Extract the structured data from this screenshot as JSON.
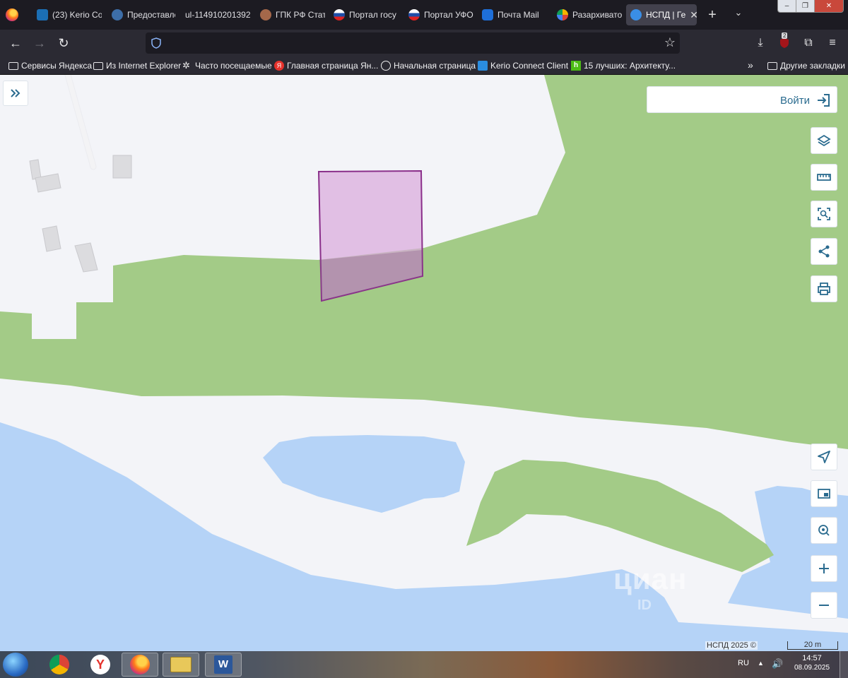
{
  "browser": {
    "tabs": [
      {
        "label": "(23) Kerio Co",
        "active": false
      },
      {
        "label": "Предоставле",
        "active": false
      },
      {
        "label": "ul-114910201392",
        "active": false
      },
      {
        "label": "ГПК РФ Стат",
        "active": false
      },
      {
        "label": "Портал госу",
        "active": false
      },
      {
        "label": "Портал УФО",
        "active": false
      },
      {
        "label": "Почта Mail",
        "active": false
      },
      {
        "label": "Разархивато",
        "active": false
      },
      {
        "label": "НСПД | Ге",
        "active": true
      }
    ],
    "url": "",
    "download_badge": "2"
  },
  "bookmarks": [
    {
      "label": "Сервисы Яндекса",
      "icon": "folder-icon"
    },
    {
      "label": "Из Internet Explorer",
      "icon": "folder-icon"
    },
    {
      "label": "Часто посещаемые",
      "icon": "gear-icon"
    },
    {
      "label": "Главная страница Ян...",
      "icon": "yandex-icon"
    },
    {
      "label": "Начальная страница",
      "icon": "globe-icon"
    },
    {
      "label": "Kerio Connect Client",
      "icon": "mail-icon"
    },
    {
      "label": "15 лучших: Архитекту...",
      "icon": "houzz-icon"
    },
    {
      "label": "Другие закладки",
      "icon": "folder-icon"
    }
  ],
  "map": {
    "login_label": "Войти",
    "watermark": "циан",
    "watermark_sub": "ID",
    "attribution": "НСПД 2025 ©",
    "scale_label": "20 m",
    "colors": {
      "land": "#f3f4f8",
      "forest": "#a3cb87",
      "water": "#b5d3f7",
      "parcel_stroke": "#8a2f8a",
      "parcel_fill": "#d9a8dc"
    }
  },
  "taskbar": {
    "language": "RU",
    "time": "14:57",
    "date": "08.09.2025"
  }
}
